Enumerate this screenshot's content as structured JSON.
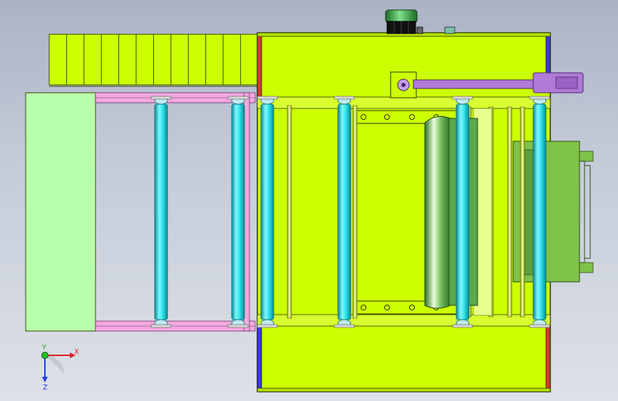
{
  "view": {
    "background_top": "#aab3c5",
    "background_bottom": "#dde1e8"
  },
  "colors": {
    "frame_lime": "#ccff00",
    "frame_outline": "#3a4a00",
    "conveyor_pale": "#b8ffac",
    "side_rail_pink": "#f4a9e0",
    "roller_cyan": "#33e8f0",
    "roller_edge": "#0a8a95",
    "motor_green": "#2f9e3a",
    "arm_purple": "#b07ad8",
    "side_plate_blue": "#3a3bd8",
    "side_plate_red": "#d43a2a",
    "roll_drum_green": "#5aa84a",
    "right_block": "#7fc24a"
  },
  "axis_triad": {
    "x_label": "X",
    "y_label": "Y",
    "z_label": "Z",
    "x_color": "#e02020",
    "y_color": "#20c020",
    "z_color": "#2040e0"
  },
  "icons": {
    "motor": "motor-icon",
    "triad": "axis-triad-icon"
  }
}
